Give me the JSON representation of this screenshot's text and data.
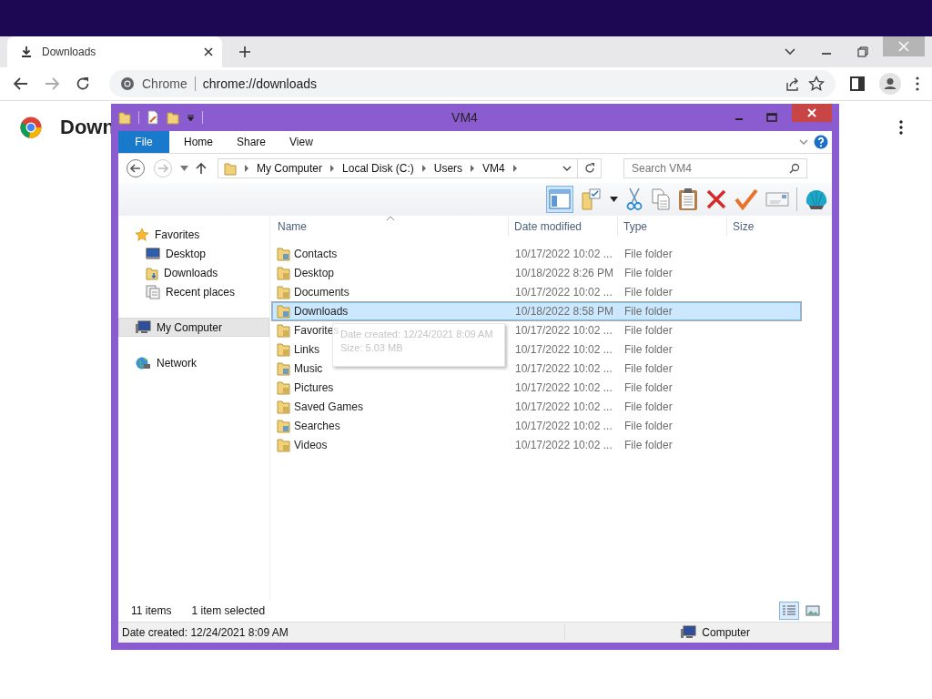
{
  "browser": {
    "tab": {
      "title": "Downloads"
    },
    "address": {
      "site": "Chrome",
      "url": "chrome://downloads"
    }
  },
  "page": {
    "heading": "Down"
  },
  "explorer": {
    "title": "VM4",
    "ribbon_tabs": [
      {
        "label": "File",
        "kind": "file",
        "selected": false
      },
      {
        "label": "Home",
        "kind": "tab",
        "selected": false
      },
      {
        "label": "Share",
        "kind": "tab",
        "selected": false
      },
      {
        "label": "View",
        "kind": "tab",
        "selected": false
      }
    ],
    "breadcrumb": [
      "My Computer",
      "Local Disk (C:)",
      "Users",
      "VM4"
    ],
    "search": {
      "placeholder": "Search VM4"
    },
    "nav": [
      {
        "label": "Favorites",
        "selected": false,
        "children": [
          {
            "label": "Desktop",
            "selected": false
          },
          {
            "label": "Downloads",
            "selected": false
          },
          {
            "label": "Recent places",
            "selected": false
          }
        ]
      },
      {
        "label": "My Computer",
        "selected": true
      },
      {
        "label": "Network",
        "selected": false
      }
    ],
    "columns": [
      "Name",
      "Date modified",
      "Type",
      "Size"
    ],
    "rows": [
      {
        "name": "Contacts",
        "date": "10/17/2022 10:02 ...",
        "type": "File folder",
        "selected": false
      },
      {
        "name": "Desktop",
        "date": "10/18/2022 8:26 PM",
        "type": "File folder",
        "selected": false
      },
      {
        "name": "Documents",
        "date": "10/17/2022 10:02 ...",
        "type": "File folder",
        "selected": false
      },
      {
        "name": "Downloads",
        "date": "10/18/2022 8:58 PM",
        "type": "File folder",
        "selected": true
      },
      {
        "name": "Favorites",
        "date": "10/17/2022 10:02 ...",
        "type": "File folder",
        "selected": false
      },
      {
        "name": "Links",
        "date": "10/17/2022 10:02 ...",
        "type": "File folder",
        "selected": false
      },
      {
        "name": "Music",
        "date": "10/17/2022 10:02 ...",
        "type": "File folder",
        "selected": false
      },
      {
        "name": "Pictures",
        "date": "10/17/2022 10:02 ...",
        "type": "File folder",
        "selected": false
      },
      {
        "name": "Saved Games",
        "date": "10/17/2022 10:02 ...",
        "type": "File folder",
        "selected": false
      },
      {
        "name": "Searches",
        "date": "10/17/2022 10:02 ...",
        "type": "File folder",
        "selected": false
      },
      {
        "name": "Videos",
        "date": "10/17/2022 10:02 ...",
        "type": "File folder",
        "selected": false
      }
    ],
    "tooltip": {
      "lines": [
        "Date created: 12/24/2021 8:09 AM",
        "Size: 5.03 MB"
      ]
    },
    "footer": {
      "count": "11 items",
      "selection": "1 item selected"
    },
    "view_buttons": [
      {
        "kind": "details",
        "selected": true
      },
      {
        "kind": "thumbnails",
        "selected": false
      }
    ],
    "status_bar": {
      "text": "Date created: 12/24/2021 8:09 AM",
      "location": "Computer"
    }
  }
}
